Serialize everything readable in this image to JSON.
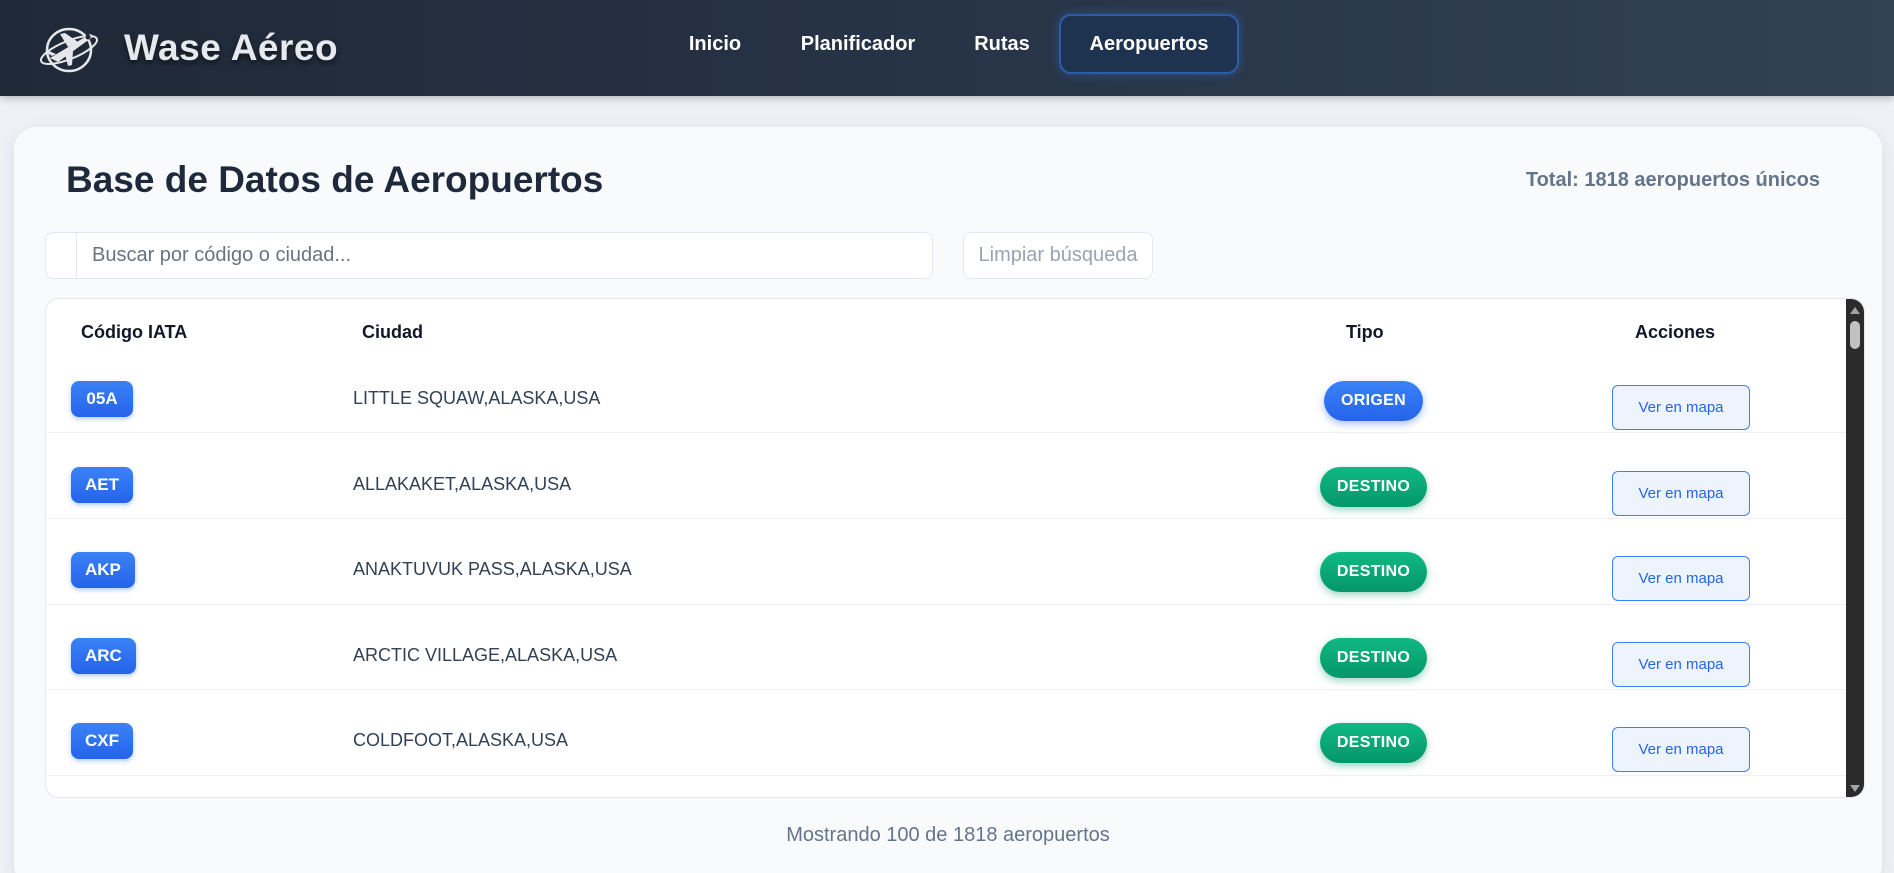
{
  "brand": {
    "title": "Wase Aéreo",
    "logo_icon": "airplane-globe-icon"
  },
  "nav": {
    "items": [
      {
        "label": "Inicio",
        "active": false
      },
      {
        "label": "Planificador",
        "active": false
      },
      {
        "label": "Rutas",
        "active": false
      },
      {
        "label": "Aeropuertos",
        "active": true
      }
    ]
  },
  "page": {
    "title": "Base de Datos de Aeropuertos",
    "total": "Total: 1818 aeropuertos únicos"
  },
  "search": {
    "placeholder": "Buscar por código o ciudad...",
    "value": "",
    "clear_label": "Limpiar búsqueda"
  },
  "table": {
    "headers": {
      "code": "Código IATA",
      "city": "Ciudad",
      "type": "Tipo",
      "actions": "Acciones"
    },
    "rows": [
      {
        "code": "05A",
        "city": "LITTLE SQUAW,ALASKA,USA",
        "type": "ORIGEN",
        "action": "Ver en mapa"
      },
      {
        "code": "AET",
        "city": "ALLAKAKET,ALASKA,USA",
        "type": "DESTINO",
        "action": "Ver en mapa"
      },
      {
        "code": "AKP",
        "city": "ANAKTUVUK PASS,ALASKA,USA",
        "type": "DESTINO",
        "action": "Ver en mapa"
      },
      {
        "code": "ARC",
        "city": "ARCTIC VILLAGE,ALASKA,USA",
        "type": "DESTINO",
        "action": "Ver en mapa"
      },
      {
        "code": "CXF",
        "city": "COLDFOOT,ALASKA,USA",
        "type": "DESTINO",
        "action": "Ver en mapa"
      }
    ]
  },
  "footer": {
    "showing": "Mostrando 100 de 1818 aeropuertos"
  },
  "colors": {
    "navbar": "#1f2937",
    "accent_blue": "#2563eb",
    "origen": "#2563eb",
    "destino": "#059669"
  }
}
